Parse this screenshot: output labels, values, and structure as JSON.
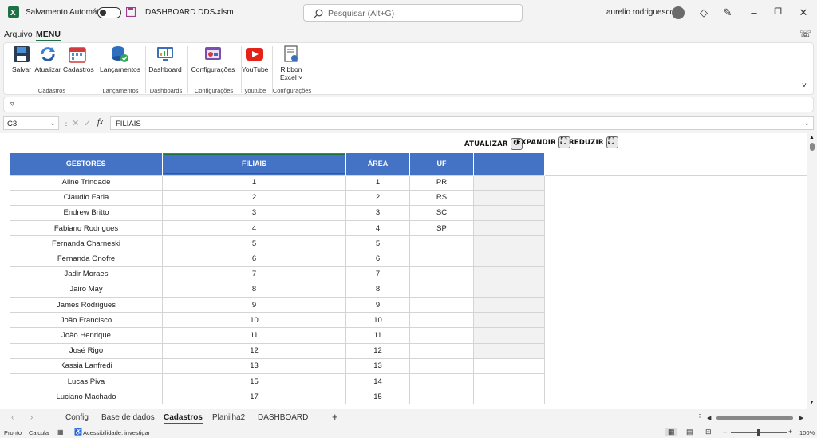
{
  "titlebar": {
    "autosave_label": "Salvamento Automático",
    "filename": "DASHBOARD DDS.xlsm",
    "search_placeholder": "Pesquisar (Alt+G)",
    "user_name": "aurelio rodriguescota"
  },
  "menu": {
    "tabs": [
      "Arquivo",
      "MENU"
    ]
  },
  "ribbon": {
    "buttons": [
      "Salvar",
      "Atualizar",
      "Cadastros",
      "Lançamentos",
      "Dashboard",
      "Configurações",
      "YouTube",
      "Ribbon",
      "Excel"
    ],
    "groups": [
      "Cadastros",
      "Lançamentos",
      "Dashboards",
      "Configurações",
      "youtube",
      "Configurações"
    ]
  },
  "formula_bar": {
    "cell_ref": "C3",
    "fx": "fx",
    "content": "FILIAIS"
  },
  "sheet_buttons": {
    "atualizar": "ATUALIZAR",
    "expandir": "EXPANDIR",
    "reduzir": "REDUZIR"
  },
  "table": {
    "headers": [
      "GESTORES",
      "FILIAIS",
      "ÁREA",
      "UF",
      ""
    ],
    "rows": [
      [
        "Aline Trindade",
        "1",
        "1",
        "PR"
      ],
      [
        "Claudio Faria",
        "2",
        "2",
        "RS"
      ],
      [
        "Endrew Britto",
        "3",
        "3",
        "SC"
      ],
      [
        "Fabiano Rodrigues",
        "4",
        "4",
        "SP"
      ],
      [
        "Fernanda Charneski",
        "5",
        "5",
        ""
      ],
      [
        "Fernanda Onofre",
        "6",
        "6",
        ""
      ],
      [
        "Jadir Moraes",
        "7",
        "7",
        ""
      ],
      [
        "Jairo May",
        "8",
        "8",
        ""
      ],
      [
        "James Rodrigues",
        "9",
        "9",
        ""
      ],
      [
        "João Francisco",
        "10",
        "10",
        ""
      ],
      [
        "João Henrique",
        "11",
        "11",
        ""
      ],
      [
        "José Rigo",
        "12",
        "12",
        ""
      ],
      [
        "Kassia Lanfredi",
        "13",
        "13",
        ""
      ],
      [
        "Lucas Piva",
        "15",
        "14",
        ""
      ],
      [
        "Luciano Machado",
        "17",
        "15",
        ""
      ]
    ]
  },
  "sheet_tabs": [
    "Config",
    "Base de dados",
    "Cadastros",
    "Planilha2",
    "DASHBOARD"
  ],
  "active_tab": "Cadastros",
  "status": {
    "ready": "Pronto",
    "calc": "Calcula",
    "accessibility": "Acessibilidade: investigar",
    "zoom": "100%"
  },
  "colors": {
    "header_blue": "#4472c4",
    "excel_green": "#1e7145",
    "grey_cell": "#f2f2f2"
  }
}
